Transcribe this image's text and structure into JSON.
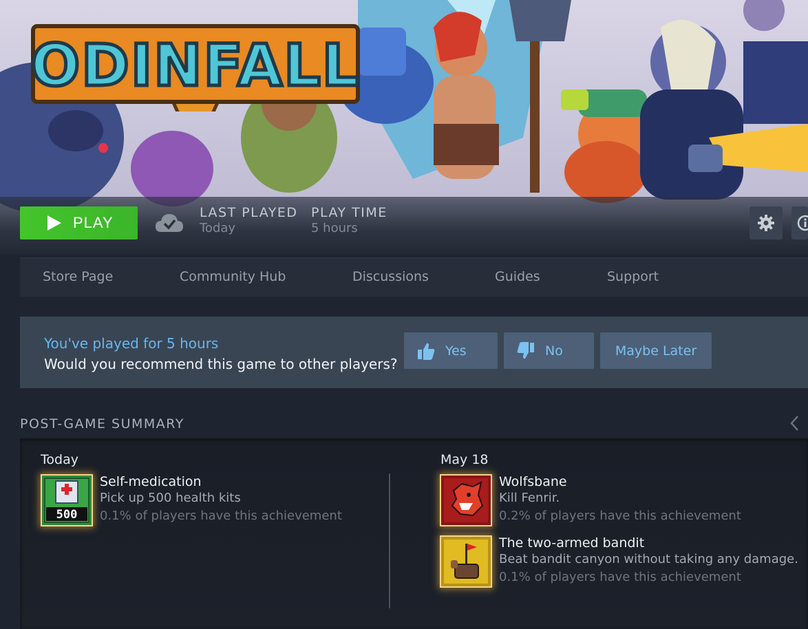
{
  "hero": {
    "logo_text": "ODINFALL"
  },
  "play_bar": {
    "play_label": "PLAY",
    "last_played_label": "LAST PLAYED",
    "last_played_value": "Today",
    "play_time_label": "PLAY TIME",
    "play_time_value": "5 hours"
  },
  "nav": [
    "Store Page",
    "Community Hub",
    "Discussions",
    "Guides",
    "Support"
  ],
  "recommend": {
    "played_text": "You've played for 5 hours",
    "question": "Would you recommend this game to other players?",
    "yes_label": "Yes",
    "no_label": "No",
    "later_label": "Maybe Later"
  },
  "summary": {
    "title": "POST-GAME SUMMARY",
    "left": {
      "date": "Today",
      "achievements": [
        {
          "name": "Self-medication",
          "desc": "Pick up 500 health kits",
          "pct": "0.1% of players have this achievement",
          "icon": "health-kit-500-icon"
        }
      ]
    },
    "right": {
      "date": "May 18",
      "achievements": [
        {
          "name": "Wolfsbane",
          "desc": "Kill Fenrir.",
          "pct": "0.2% of players have this achievement",
          "icon": "wolf-head-icon"
        },
        {
          "name": "The two-armed bandit",
          "desc": "Beat bandit canyon without taking any damage.",
          "pct": "0.1% of players have this achievement",
          "icon": "bandit-flag-icon"
        }
      ]
    }
  },
  "colors": {
    "play_green": "#45c42c",
    "accent_blue": "#64b8ef",
    "button_blue": "#4d6077"
  }
}
